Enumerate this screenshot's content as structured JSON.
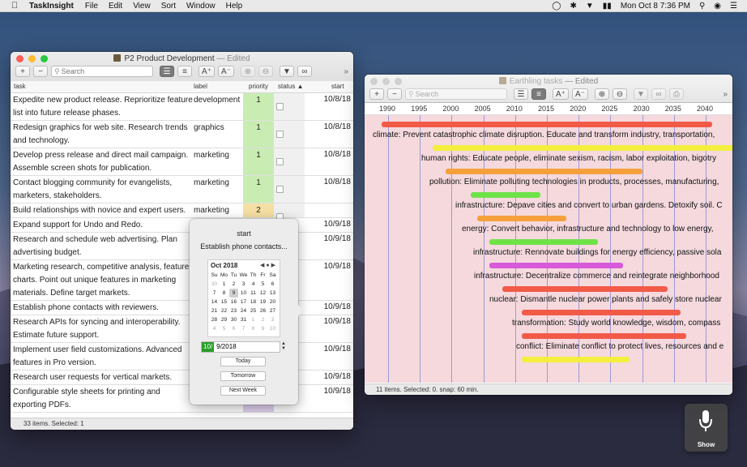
{
  "menubar": {
    "app": "TaskInsight",
    "items": [
      "File",
      "Edit",
      "View",
      "Sort",
      "Window",
      "Help"
    ],
    "clock": "Mon Oct 8  7:36 PM"
  },
  "win1": {
    "title": "P2 Product Development",
    "edited": "— Edited",
    "search_placeholder": "Search",
    "columns": {
      "task": "task",
      "label": "label",
      "priority": "priority",
      "status": "status",
      "start": "start"
    },
    "rows": [
      {
        "task": "Expedite new product release. Reprioritize feature list into future release phases.",
        "label": "development",
        "priority": "1",
        "priority_color": "#c9ecb3",
        "start": "10/8/18"
      },
      {
        "task": "Redesign graphics for web site. Research trends and technology.",
        "label": "graphics",
        "priority": "1",
        "priority_color": "#c9ecb3",
        "start": "10/8/18"
      },
      {
        "task": "Develop press release and direct mail campaign. Assemble screen shots for publication.",
        "label": "marketing",
        "priority": "1",
        "priority_color": "#c9ecb3",
        "start": "10/8/18"
      },
      {
        "task": "Contact blogging community for evangelists, marketers, stakeholders.",
        "label": "marketing",
        "priority": "1",
        "priority_color": "#c9ecb3",
        "start": "10/8/18"
      },
      {
        "task": "Build relationships with novice and expert users.",
        "label": "marketing",
        "priority": "2",
        "priority_color": "#f5dfa4",
        "start": ""
      },
      {
        "task": "Expand support for Undo and Redo.",
        "label": "",
        "priority": "",
        "priority_color": "",
        "start": "10/9/18"
      },
      {
        "task": "Research and schedule web advertising. Plan advertising budget.",
        "label": "",
        "priority": "",
        "priority_color": "",
        "start": "10/9/18"
      },
      {
        "task": "Marketing research, competitive analysis, feature charts. Point out unique features in marketing materials. Define target markets.",
        "label": "",
        "priority": "",
        "priority_color": "",
        "start": "10/9/18"
      },
      {
        "task": "Establish phone contacts with reviewers.",
        "label": "",
        "priority": "",
        "priority_color": "",
        "start": "10/9/18"
      },
      {
        "task": "Research APIs for syncing and interoperability. Estimate future support.",
        "label": "",
        "priority": "",
        "priority_color": "",
        "start": "10/9/18"
      },
      {
        "task": "Implement user field customizations. Advanced features in Pro version.",
        "label": "",
        "priority": "",
        "priority_color": "",
        "start": "10/9/18"
      },
      {
        "task": "Research user requests for vertical markets.",
        "label": "",
        "priority": "",
        "priority_color": "",
        "start": "10/9/18"
      },
      {
        "task": "Configurable style sheets for printing and exporting PDFs.",
        "label": "",
        "priority": "",
        "priority_color": "#e2d3f1",
        "start": "10/9/18"
      }
    ],
    "status": "33 items. Selected: 1"
  },
  "popover": {
    "title": "start",
    "task": "Establish phone contacts...",
    "month": "Oct 2018",
    "weekdays": [
      "Su",
      "Mo",
      "Tu",
      "We",
      "Th",
      "Fr",
      "Sa"
    ],
    "weeks": [
      [
        "30",
        "1",
        "2",
        "3",
        "4",
        "5",
        "6"
      ],
      [
        "7",
        "8",
        "9",
        "10",
        "11",
        "12",
        "13"
      ],
      [
        "14",
        "15",
        "16",
        "17",
        "18",
        "19",
        "20"
      ],
      [
        "21",
        "22",
        "23",
        "24",
        "25",
        "26",
        "27"
      ],
      [
        "28",
        "29",
        "30",
        "31",
        "1",
        "2",
        "3"
      ],
      [
        "4",
        "5",
        "6",
        "7",
        "8",
        "9",
        "10"
      ]
    ],
    "selected_day": "9",
    "date_highlight": "10/",
    "date_rest": "9/2018",
    "buttons": [
      "Today",
      "Tomorrow",
      "Next Week"
    ]
  },
  "win2": {
    "title": "Earthling tasks",
    "edited": "— Edited",
    "search_placeholder": "Search",
    "years": [
      "1990",
      "1995",
      "2000",
      "2005",
      "2010",
      "2015",
      "2020",
      "2025",
      "2030",
      "2035",
      "2040"
    ],
    "tasks": [
      {
        "text": "climate: Prevent catastrophic climate disruption. Educate and transform industry, transportation,",
        "bar_start": 1989,
        "bar_end": 2041,
        "color": "#f25a48"
      },
      {
        "text": "human rights: Educate people, eliminate sexism, racism, labor exploitation, bigotry",
        "bar_start": 1997,
        "bar_end": 2046,
        "color": "#f4ef3e"
      },
      {
        "text": "pollution: Eliminate polluting technologies in products, processes, manufacturing,",
        "bar_start": 1999,
        "bar_end": 2030,
        "color": "#f6a03c"
      },
      {
        "text": "infrastructure: Depave cities and convert to urban gardens. Detoxify soil. C",
        "bar_start": 2003,
        "bar_end": 2014,
        "color": "#6fe24a"
      },
      {
        "text": "energy: Convert behavior, infrastructure and technology to low energy,",
        "bar_start": 2004,
        "bar_end": 2018,
        "color": "#f6a03c"
      },
      {
        "text": "infrastructure: Rennovate buildings for energy efficiency, passive sola",
        "bar_start": 2006,
        "bar_end": 2023,
        "color": "#6fe24a"
      },
      {
        "text": "infrastructure: Decentralize commerce and reintegrate neighborhood",
        "bar_start": 2006,
        "bar_end": 2027,
        "color": "#d65ad9"
      },
      {
        "text": "nuclear: Dismantle nuclear power plants and safely store nuclear",
        "bar_start": 2008,
        "bar_end": 2034,
        "color": "#f25a48"
      },
      {
        "text": "transformation: Study world knowledge, wisdom, compass",
        "bar_start": 2011,
        "bar_end": 2036,
        "color": "#f25a48"
      },
      {
        "text": "conflict: Eliminate conflict to protect lives, resources and e",
        "bar_start": 2011,
        "bar_end": 2037,
        "color": "#f25a48"
      },
      {
        "text": "",
        "bar_start": 2011,
        "bar_end": 2028,
        "color": "#f4ef3e"
      }
    ],
    "status": "11 items. Selected: 0.  snap: 60 min."
  },
  "show_widget": {
    "label": "Show"
  }
}
